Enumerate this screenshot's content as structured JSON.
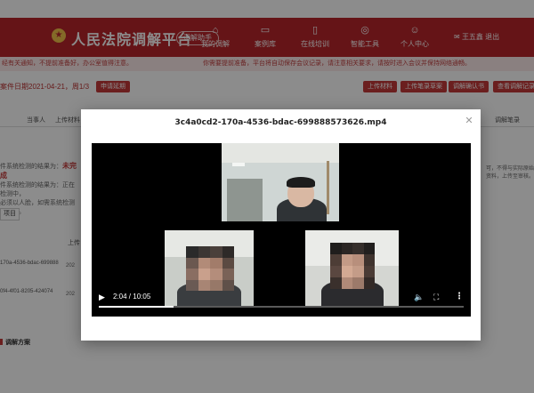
{
  "header": {
    "site_title": "人民法院调解平台",
    "badge": "调解助手",
    "nav": [
      {
        "label": "我的调解",
        "icon": "house-icon"
      },
      {
        "label": "案例库",
        "icon": "briefcase-icon"
      },
      {
        "label": "在线培训",
        "icon": "book-icon"
      },
      {
        "label": "智能工具",
        "icon": "compass-icon"
      },
      {
        "label": "个人中心",
        "icon": "user-icon"
      }
    ],
    "user": {
      "icon": "mail-icon",
      "name": "王五鑫",
      "logout": "退出"
    }
  },
  "background": {
    "notice_left": "经有关通知，不提前准备好，办公室值得注意。",
    "notice_center": "你需要提前准备，平台将自动保存会议记录，请注意相关要求，请按时进入会议并保持网络通畅。",
    "date_text": "案件日期2021-04-21，周1/3",
    "btn_left": "申请延期",
    "buttons": [
      "上传材料",
      "上传笔录草案",
      "调解确认书",
      "查看调解记录"
    ],
    "tabs": [
      "当事人",
      "上传材料",
      "调解笔录"
    ],
    "side_title": "件系统检测的结果为：",
    "side_highlight": "未完成",
    "side_line1": "件系统检测的结果为：正在检测中，",
    "side_line2": "必须以人脸，如需系统检测请点击。",
    "mini_btn": "项目",
    "upload_header": "上传",
    "files": [
      "170a-4536-bdac-699888",
      "0f4-4f01-8205-424074"
    ],
    "years": [
      "202",
      "202"
    ],
    "right_text": "可，不得与实际原始资料，上传至审核。",
    "plan_label": "调解方案"
  },
  "modal": {
    "title": "3c4a0cd2-170a-4536-bdac-699888573626.mp4",
    "close_icon": "close-icon"
  },
  "video": {
    "current_time": "2:04",
    "duration": "10:05",
    "time_sep": " / ",
    "progress": 0.205,
    "play_icon": "play-icon",
    "volume_icon": "volume-icon",
    "fullscreen_icon": "fullscreen-icon",
    "more_icon": "more-vertical-icon"
  }
}
